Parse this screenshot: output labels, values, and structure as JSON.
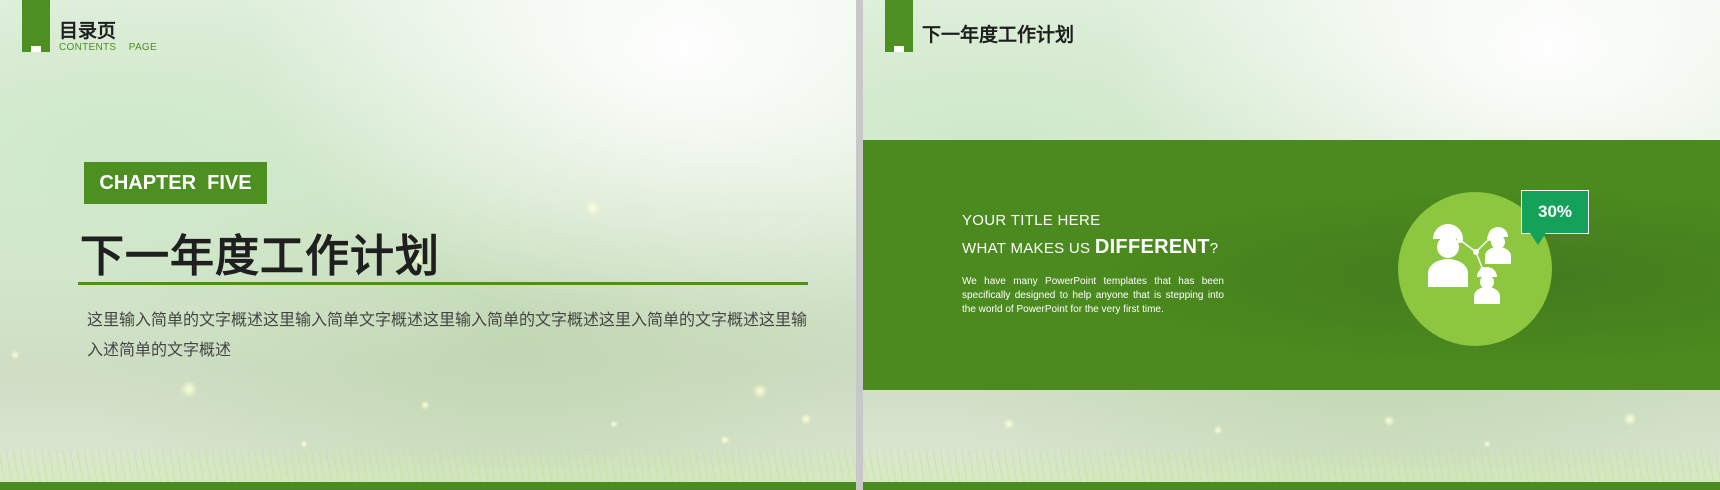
{
  "slide_left": {
    "header": {
      "title": "目录页",
      "subtitle": "CONTENTS    PAGE"
    },
    "chapter_label": "CHAPTER  FIVE",
    "main_title": "下一年度工作计划",
    "description": "这里输入简单的文字概述这里输入简单文字概述这里输入简单的文字概述这里入简单的文字概述这里输入述简单的文字概述"
  },
  "slide_right": {
    "header": {
      "title": "下一年度工作计划"
    },
    "title_line1": "YOUR TITLE HERE",
    "title_line2_prefix": "WHAT MAKES US ",
    "title_line2_accent": "DIFFERENT",
    "title_line2_suffix": "?",
    "body": "We have many PowerPoint templates that has been specifically designed to help anyone that is stepping into the world of PowerPoint for the very first time.",
    "percent": "30%",
    "icon": "team-network-icon"
  },
  "colors": {
    "brand_green": "#4e8f22",
    "band_green": "#4b8a1e",
    "circle_green": "#8dc63f",
    "bubble_green": "#14a15a"
  }
}
